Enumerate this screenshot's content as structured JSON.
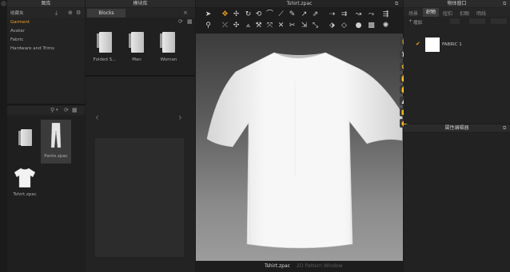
{
  "library": {
    "header": "图库",
    "favorites_label": "收藏夹",
    "tree": [
      "Garment",
      "Avatar",
      "Fabric",
      "Hardware and Trims"
    ],
    "selected_index": 0,
    "files": [
      {
        "name": "",
        "type": "folder"
      },
      {
        "name": "Pants.zpac",
        "type": "pants"
      },
      {
        "name": "Tshirt.zpac",
        "type": "tshirt"
      }
    ]
  },
  "module_library": {
    "header": "模块库",
    "tab": "Blocks",
    "items": [
      "Folded S...",
      "Man",
      "Woman"
    ],
    "nav_prev": "‹",
    "nav_next": "›"
  },
  "viewport": {
    "title": "Tshirt.zpac",
    "bottom_tab_active": "Tshirt.zpac",
    "bottom_tab_inactive": "2D Pattern Window"
  },
  "object_window": {
    "header": "物体窗口",
    "tabs": [
      "场景",
      "织物",
      "纽扣",
      "扣眼",
      "明线"
    ],
    "active_tab_index": 1,
    "add_label": "增加",
    "fabric_name": "FABRIC 1",
    "check": "✔"
  },
  "property_editor": {
    "header": "属性编辑器"
  },
  "colors": {
    "accent_orange": "#f2a020",
    "viewport_bg_top": "#3c3c3c",
    "viewport_bg_bottom": "#9c9c9c",
    "panel_bg": "#232323"
  }
}
